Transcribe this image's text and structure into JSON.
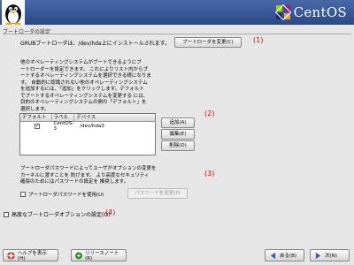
{
  "header": {
    "brand": "CentOS"
  },
  "section_title": "ブートローダの設定",
  "grub": {
    "text": "GRUBブートローダは、/dev/hda上にインストールされます。",
    "change_button": "ブートローダを変更(C)",
    "marker": "(1)"
  },
  "os_section": {
    "description": "他のオペレーティングシステムがブートできるようにブ\nートローダーを設定できます。 これによりリスト内からブ\nートするオペレーティングシステムを選択できる様になりま\nす。 自動的に認識されない他のオペレーティングシステム\nを追加するには、「追加」をクリックします。デフォルト\nでブートするオペレーティングシステムを変更する には、\n目的のオペレーティングシステムの側の「デフォルト」を\n選択します。",
    "columns": [
      "デフォルト",
      "ラベル",
      "デバイス"
    ],
    "rows": [
      {
        "default": "✓",
        "label": "CentOS-3",
        "device": "/dev/hda3"
      }
    ],
    "add_button": "追加(A)",
    "edit_button": "編集(E)",
    "delete_button": "削除(D)",
    "marker": "(2)"
  },
  "password_section": {
    "description": "ブートローダパスワードによってユーザがオプションの変更を\nカーネルに渡すことを 防げます。 より高度なセキュリティ\n確保のためにはパスワードの設定を 推奨します。",
    "checkbox_label": "ブートローダパスワードを使用(U)",
    "change_password_button": "パスワードを変更(P)",
    "marker": "(3)"
  },
  "advanced": {
    "checkbox_label": "高度なブートローダオプションの設定(O)",
    "marker": "(4)"
  },
  "footer": {
    "help_button": "ヘルプを表示(H)",
    "release_notes_button": "リリースノート(R)",
    "back_button": "戻る(B)",
    "next_button": "次(N)"
  },
  "colors": {
    "marker": "#e00000",
    "header": "#3b5a98"
  }
}
